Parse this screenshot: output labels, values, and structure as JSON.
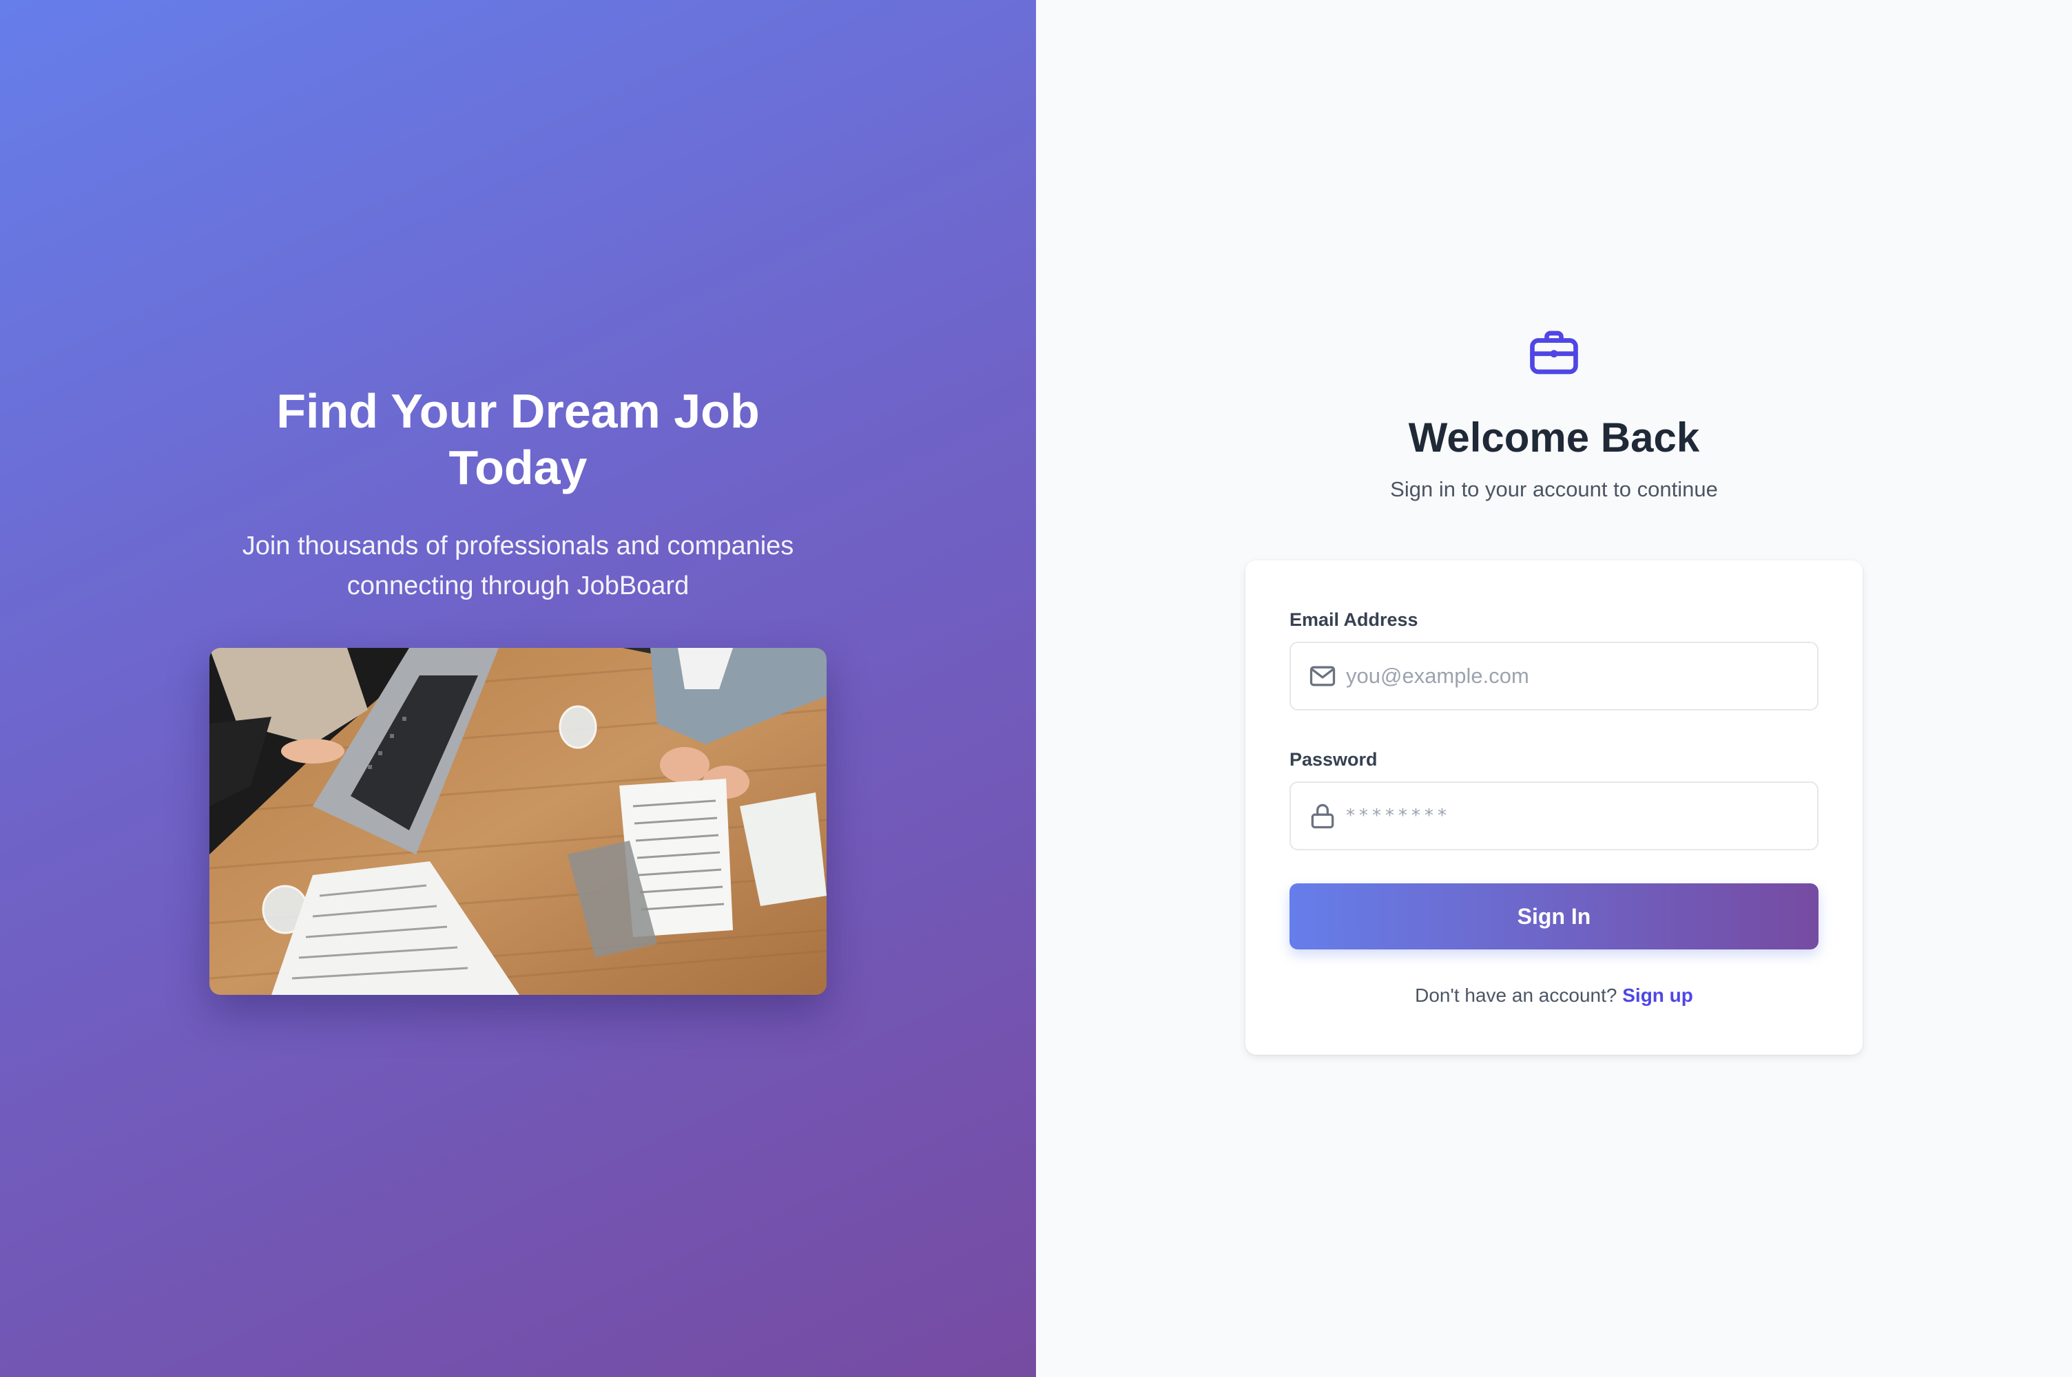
{
  "hero": {
    "title": "Find Your Dream Job Today",
    "subtitle": "Join thousands of professionals and companies connecting through JobBoard",
    "image_icon": "office-meeting-photo"
  },
  "auth": {
    "brand_icon": "briefcase-icon",
    "title": "Welcome Back",
    "subtitle": "Sign in to your account to continue",
    "email": {
      "label": "Email Address",
      "placeholder": "you@example.com",
      "value": "",
      "icon": "mail-icon"
    },
    "password": {
      "label": "Password",
      "placeholder": "********",
      "value": "",
      "icon": "lock-icon"
    },
    "submit_label": "Sign In",
    "signup_prompt": "Don't have an account?",
    "signup_link": "Sign up"
  },
  "colors": {
    "gradient_start": "#667eea",
    "gradient_end": "#764ba2",
    "accent": "#4f46e5",
    "heading": "#1f2937",
    "muted": "#4b5563",
    "panel_bg": "#f9fafb"
  }
}
